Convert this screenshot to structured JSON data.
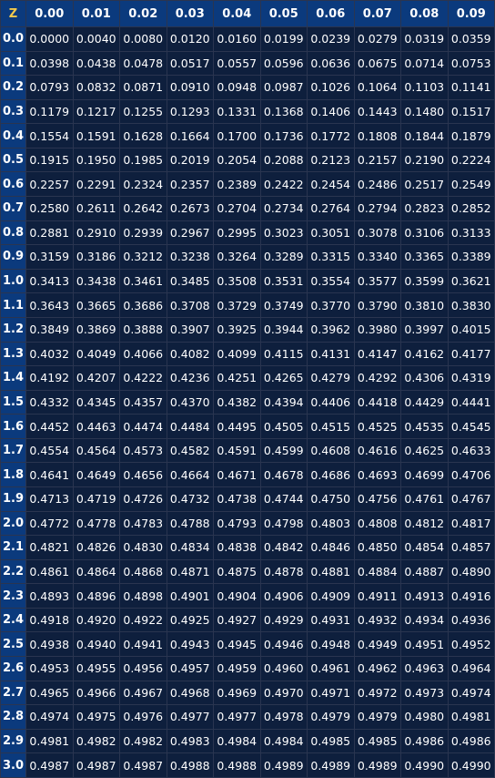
{
  "table": {
    "corner_label": "Z",
    "columns": [
      "0.00",
      "0.01",
      "0.02",
      "0.03",
      "0.04",
      "0.05",
      "0.06",
      "0.07",
      "0.08",
      "0.09"
    ],
    "rows": [
      {
        "z": "0.0",
        "values": [
          "0.0000",
          "0.0040",
          "0.0080",
          "0.0120",
          "0.0160",
          "0.0199",
          "0.0239",
          "0.0279",
          "0.0319",
          "0.0359"
        ]
      },
      {
        "z": "0.1",
        "values": [
          "0.0398",
          "0.0438",
          "0.0478",
          "0.0517",
          "0.0557",
          "0.0596",
          "0.0636",
          "0.0675",
          "0.0714",
          "0.0753"
        ]
      },
      {
        "z": "0.2",
        "values": [
          "0.0793",
          "0.0832",
          "0.0871",
          "0.0910",
          "0.0948",
          "0.0987",
          "0.1026",
          "0.1064",
          "0.1103",
          "0.1141"
        ]
      },
      {
        "z": "0.3",
        "values": [
          "0.1179",
          "0.1217",
          "0.1255",
          "0.1293",
          "0.1331",
          "0.1368",
          "0.1406",
          "0.1443",
          "0.1480",
          "0.1517"
        ]
      },
      {
        "z": "0.4",
        "values": [
          "0.1554",
          "0.1591",
          "0.1628",
          "0.1664",
          "0.1700",
          "0.1736",
          "0.1772",
          "0.1808",
          "0.1844",
          "0.1879"
        ]
      },
      {
        "z": "0.5",
        "values": [
          "0.1915",
          "0.1950",
          "0.1985",
          "0.2019",
          "0.2054",
          "0.2088",
          "0.2123",
          "0.2157",
          "0.2190",
          "0.2224"
        ]
      },
      {
        "z": "0.6",
        "values": [
          "0.2257",
          "0.2291",
          "0.2324",
          "0.2357",
          "0.2389",
          "0.2422",
          "0.2454",
          "0.2486",
          "0.2517",
          "0.2549"
        ]
      },
      {
        "z": "0.7",
        "values": [
          "0.2580",
          "0.2611",
          "0.2642",
          "0.2673",
          "0.2704",
          "0.2734",
          "0.2764",
          "0.2794",
          "0.2823",
          "0.2852"
        ]
      },
      {
        "z": "0.8",
        "values": [
          "0.2881",
          "0.2910",
          "0.2939",
          "0.2967",
          "0.2995",
          "0.3023",
          "0.3051",
          "0.3078",
          "0.3106",
          "0.3133"
        ]
      },
      {
        "z": "0.9",
        "values": [
          "0.3159",
          "0.3186",
          "0.3212",
          "0.3238",
          "0.3264",
          "0.3289",
          "0.3315",
          "0.3340",
          "0.3365",
          "0.3389"
        ]
      },
      {
        "z": "1.0",
        "values": [
          "0.3413",
          "0.3438",
          "0.3461",
          "0.3485",
          "0.3508",
          "0.3531",
          "0.3554",
          "0.3577",
          "0.3599",
          "0.3621"
        ]
      },
      {
        "z": "1.1",
        "values": [
          "0.3643",
          "0.3665",
          "0.3686",
          "0.3708",
          "0.3729",
          "0.3749",
          "0.3770",
          "0.3790",
          "0.3810",
          "0.3830"
        ]
      },
      {
        "z": "1.2",
        "values": [
          "0.3849",
          "0.3869",
          "0.3888",
          "0.3907",
          "0.3925",
          "0.3944",
          "0.3962",
          "0.3980",
          "0.3997",
          "0.4015"
        ]
      },
      {
        "z": "1.3",
        "values": [
          "0.4032",
          "0.4049",
          "0.4066",
          "0.4082",
          "0.4099",
          "0.4115",
          "0.4131",
          "0.4147",
          "0.4162",
          "0.4177"
        ]
      },
      {
        "z": "1.4",
        "values": [
          "0.4192",
          "0.4207",
          "0.4222",
          "0.4236",
          "0.4251",
          "0.4265",
          "0.4279",
          "0.4292",
          "0.4306",
          "0.4319"
        ]
      },
      {
        "z": "1.5",
        "values": [
          "0.4332",
          "0.4345",
          "0.4357",
          "0.4370",
          "0.4382",
          "0.4394",
          "0.4406",
          "0.4418",
          "0.4429",
          "0.4441"
        ]
      },
      {
        "z": "1.6",
        "values": [
          "0.4452",
          "0.4463",
          "0.4474",
          "0.4484",
          "0.4495",
          "0.4505",
          "0.4515",
          "0.4525",
          "0.4535",
          "0.4545"
        ]
      },
      {
        "z": "1.7",
        "values": [
          "0.4554",
          "0.4564",
          "0.4573",
          "0.4582",
          "0.4591",
          "0.4599",
          "0.4608",
          "0.4616",
          "0.4625",
          "0.4633"
        ]
      },
      {
        "z": "1.8",
        "values": [
          "0.4641",
          "0.4649",
          "0.4656",
          "0.4664",
          "0.4671",
          "0.4678",
          "0.4686",
          "0.4693",
          "0.4699",
          "0.4706"
        ]
      },
      {
        "z": "1.9",
        "values": [
          "0.4713",
          "0.4719",
          "0.4726",
          "0.4732",
          "0.4738",
          "0.4744",
          "0.4750",
          "0.4756",
          "0.4761",
          "0.4767"
        ]
      },
      {
        "z": "2.0",
        "values": [
          "0.4772",
          "0.4778",
          "0.4783",
          "0.4788",
          "0.4793",
          "0.4798",
          "0.4803",
          "0.4808",
          "0.4812",
          "0.4817"
        ]
      },
      {
        "z": "2.1",
        "values": [
          "0.4821",
          "0.4826",
          "0.4830",
          "0.4834",
          "0.4838",
          "0.4842",
          "0.4846",
          "0.4850",
          "0.4854",
          "0.4857"
        ]
      },
      {
        "z": "2.2",
        "values": [
          "0.4861",
          "0.4864",
          "0.4868",
          "0.4871",
          "0.4875",
          "0.4878",
          "0.4881",
          "0.4884",
          "0.4887",
          "0.4890"
        ]
      },
      {
        "z": "2.3",
        "values": [
          "0.4893",
          "0.4896",
          "0.4898",
          "0.4901",
          "0.4904",
          "0.4906",
          "0.4909",
          "0.4911",
          "0.4913",
          "0.4916"
        ]
      },
      {
        "z": "2.4",
        "values": [
          "0.4918",
          "0.4920",
          "0.4922",
          "0.4925",
          "0.4927",
          "0.4929",
          "0.4931",
          "0.4932",
          "0.4934",
          "0.4936"
        ]
      },
      {
        "z": "2.5",
        "values": [
          "0.4938",
          "0.4940",
          "0.4941",
          "0.4943",
          "0.4945",
          "0.4946",
          "0.4948",
          "0.4949",
          "0.4951",
          "0.4952"
        ]
      },
      {
        "z": "2.6",
        "values": [
          "0.4953",
          "0.4955",
          "0.4956",
          "0.4957",
          "0.4959",
          "0.4960",
          "0.4961",
          "0.4962",
          "0.4963",
          "0.4964"
        ]
      },
      {
        "z": "2.7",
        "values": [
          "0.4965",
          "0.4966",
          "0.4967",
          "0.4968",
          "0.4969",
          "0.4970",
          "0.4971",
          "0.4972",
          "0.4973",
          "0.4974"
        ]
      },
      {
        "z": "2.8",
        "values": [
          "0.4974",
          "0.4975",
          "0.4976",
          "0.4977",
          "0.4977",
          "0.4978",
          "0.4979",
          "0.4979",
          "0.4980",
          "0.4981"
        ]
      },
      {
        "z": "2.9",
        "values": [
          "0.4981",
          "0.4982",
          "0.4982",
          "0.4983",
          "0.4984",
          "0.4984",
          "0.4985",
          "0.4985",
          "0.4986",
          "0.4986"
        ]
      },
      {
        "z": "3.0",
        "values": [
          "0.4987",
          "0.4987",
          "0.4987",
          "0.4988",
          "0.4988",
          "0.4989",
          "0.4989",
          "0.4989",
          "0.4990",
          "0.4990"
        ]
      }
    ]
  },
  "colors": {
    "header_bg": "#0b3a7d",
    "cell_bg": "#0e1f3d",
    "grid": "#2a3550",
    "corner_text": "#f2c94c",
    "text": "#ffffff"
  }
}
